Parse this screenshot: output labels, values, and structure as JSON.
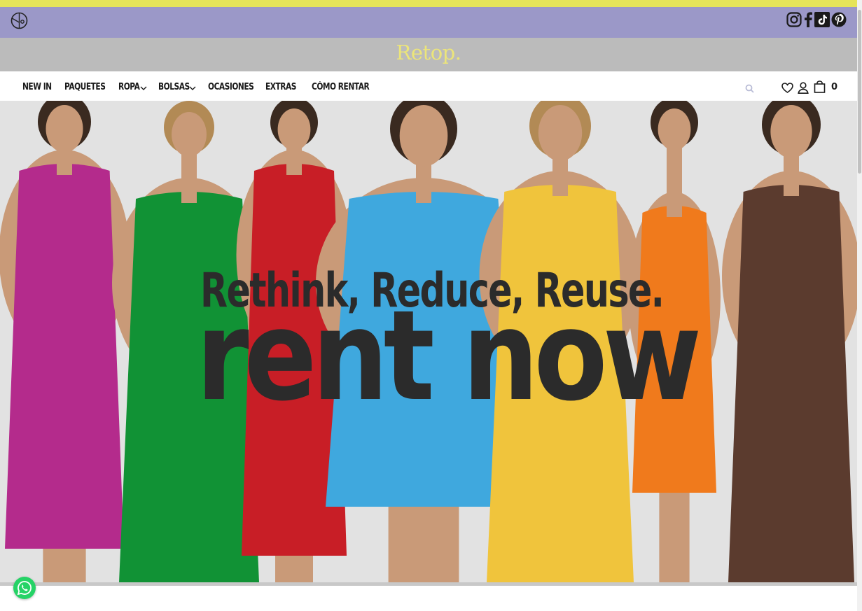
{
  "brand": {
    "logo_text": "Retop."
  },
  "social": [
    "instagram-icon",
    "facebook-icon",
    "tiktok-icon",
    "pinterest-icon"
  ],
  "nav": {
    "items": [
      {
        "label": "NEW IN",
        "has_dropdown": false
      },
      {
        "label": "PAQUETES",
        "has_dropdown": false
      },
      {
        "label": "ROPA",
        "has_dropdown": true
      },
      {
        "label": "BOLSAS",
        "has_dropdown": true
      },
      {
        "label": "OCASIONES",
        "has_dropdown": false
      },
      {
        "label": "EXTRAS",
        "has_dropdown": false
      },
      {
        "label": "CÓMO RENTAR",
        "has_dropdown": false
      }
    ]
  },
  "header_icons": [
    "search-icon",
    "heart-icon",
    "user-icon",
    "bag-icon"
  ],
  "cart": {
    "count": "0"
  },
  "hero": {
    "tagline": "Rethink, Reduce, Reuse.",
    "headline": "rent now",
    "dress_colors": [
      "#b42b8c",
      "#119235",
      "#c81e26",
      "#3fa8de",
      "#f0c43c",
      "#f07a1c",
      "#5b3b2e"
    ]
  },
  "colors": {
    "top_strip": "#e5e45a",
    "social_bar": "#9b98c8",
    "brand_bar": "#bbbbbb",
    "logo": "#ece57a",
    "whatsapp": "#25d366"
  }
}
